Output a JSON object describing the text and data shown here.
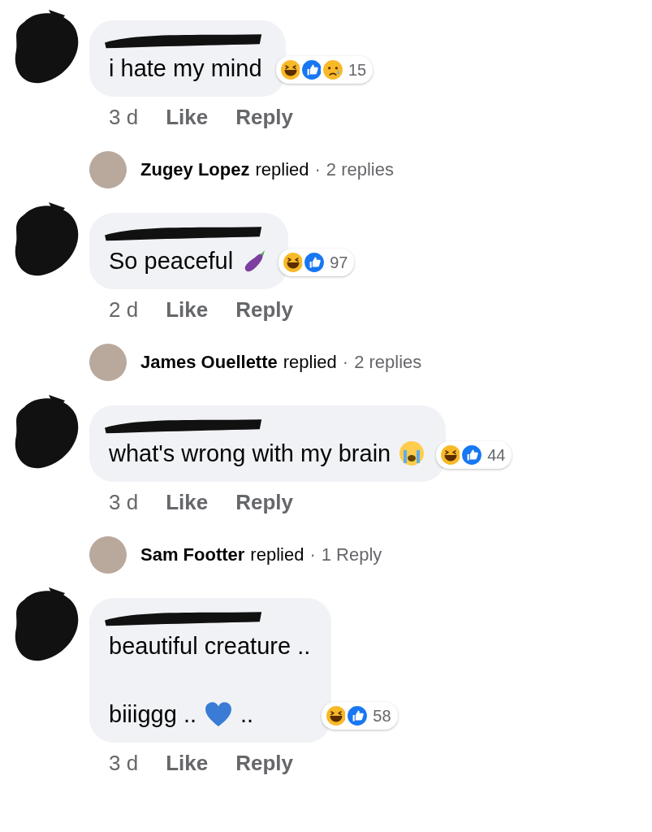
{
  "comments": [
    {
      "lines": [
        "i hate my mind"
      ],
      "reactions": [
        {
          "kind": "haha"
        },
        {
          "kind": "like"
        },
        {
          "kind": "sad"
        }
      ],
      "count": "15",
      "time": "3 d",
      "like": "Like",
      "reply": "Reply",
      "thread": {
        "name": "Zugey Lopez",
        "replied": "replied",
        "dot": "·",
        "replies": "2 replies"
      }
    },
    {
      "lines": [
        "So peaceful"
      ],
      "emoji": {
        "kind": "eggplant"
      },
      "reactions": [
        {
          "kind": "haha"
        },
        {
          "kind": "like"
        }
      ],
      "count": "97",
      "time": "2 d",
      "like": "Like",
      "reply": "Reply",
      "thread": {
        "name": "James Ouellette",
        "replied": "replied",
        "dot": "·",
        "replies": "2 replies"
      }
    },
    {
      "lines": [
        "what's wrong with my brain"
      ],
      "emoji": {
        "kind": "crying"
      },
      "reactions": [
        {
          "kind": "haha"
        },
        {
          "kind": "like"
        }
      ],
      "count": "44",
      "time": "3 d",
      "like": "Like",
      "reply": "Reply",
      "thread": {
        "name": "Sam Footter",
        "replied": "replied",
        "dot": "·",
        "replies": "1 Reply"
      }
    },
    {
      "lines": [
        "beautiful creature ..",
        "biiiggg ..",
        ".."
      ],
      "emoji": {
        "kind": "heart"
      },
      "reactions": [
        {
          "kind": "haha"
        },
        {
          "kind": "like"
        }
      ],
      "count": "58",
      "time": "3 d",
      "like": "Like",
      "reply": "Reply"
    }
  ]
}
